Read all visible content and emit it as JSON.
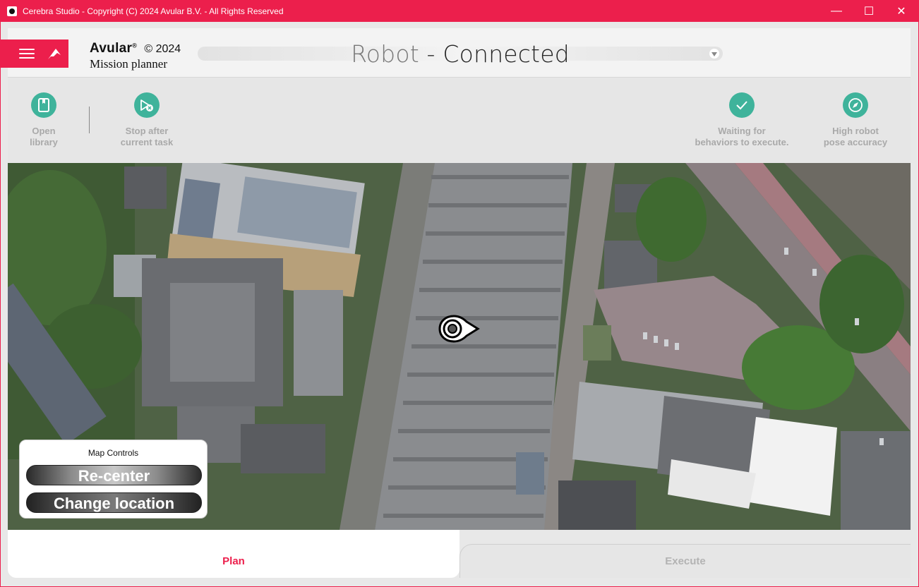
{
  "window": {
    "title": "Cerebra Studio - Copyright (C) 2024 Avular B.V. - All Rights Reserved",
    "min_glyph": "—",
    "max_glyph": "☐",
    "close_glyph": "✕"
  },
  "header": {
    "brand_name": "Avular",
    "brand_reg": "®",
    "brand_copyright": "© 2024",
    "brand_sub": "Mission planner",
    "robot_word": "Robot",
    "robot_status": " - Connected"
  },
  "toolbar": {
    "open_library": "Open\nlibrary",
    "stop_after": "Stop after\ncurrent task",
    "waiting": "Waiting for\nbehaviors to execute.",
    "pose": "High robot\npose accuracy"
  },
  "map_controls": {
    "title": "Map Controls",
    "recenter": "Re-center",
    "change_location": "Change location"
  },
  "tabs": {
    "plan": "Plan",
    "execute": "Execute"
  },
  "colors": {
    "brand": "#ec1f4c",
    "accent": "#3fb39b"
  },
  "icons": {
    "app": "cerebra-app-icon",
    "menu": "hamburger-icon",
    "logo": "avular-logo-icon",
    "open_library": "book-icon",
    "stop_after": "play-stop-icon",
    "waiting": "check-icon",
    "pose": "compass-icon",
    "robot_marker": "robot-location-icon"
  }
}
